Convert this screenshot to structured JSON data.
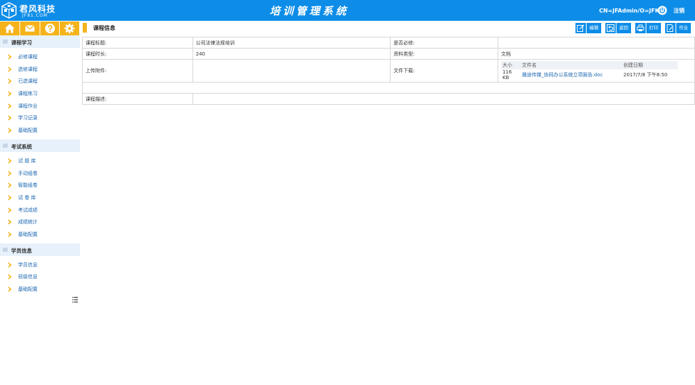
{
  "header": {
    "logo_text": "君风科技",
    "logo_sub": "JF81.COM",
    "system_title": "培训管理系统",
    "user_cn": "CN=JFAdmin/O=JFKJ",
    "logout_label": "注销"
  },
  "sidebar": {
    "sections": [
      {
        "title": "课程学习",
        "items": [
          "必修课程",
          "选修课程",
          "已选课程",
          "课程练习",
          "课程作业",
          "学习记录",
          "基础配置"
        ]
      },
      {
        "title": "考试系统",
        "items": [
          "试 题 库",
          "手动组卷",
          "智能组卷",
          "试 卷 库",
          "考试成绩",
          "成绩统计",
          "基础配置"
        ]
      },
      {
        "title": "学员信息",
        "items": [
          "学员信息",
          "班级信息",
          "基础配置"
        ]
      }
    ]
  },
  "page": {
    "title": "课程信息",
    "actions": {
      "edit": "编辑",
      "back": "返回",
      "print": "打印",
      "homework": "作业"
    }
  },
  "info": {
    "title_label": "课程标题:",
    "title_value": "公司法律法规培训",
    "required_label": "是否必修:",
    "required_value": "",
    "duration_label": "课程时长:",
    "duration_value": "240",
    "type_label": "资料类型:",
    "type_value": "文档",
    "attach_label": "上传附件:",
    "download_label": "文件下载:",
    "desc_label": "课程描述:",
    "desc_value": ""
  },
  "files": {
    "headers": {
      "size": "大小",
      "name": "文件名",
      "date": "创建日期"
    },
    "rows": [
      {
        "size": "116 KB",
        "name": "雅途传媒_协同办公系统立项报告.doc",
        "date": "2017/7/8 下午8:50"
      }
    ]
  },
  "colors": {
    "header_blue": "#0e8de8",
    "accent_yellow": "#f5b31b",
    "link_blue": "#1a66b0"
  }
}
